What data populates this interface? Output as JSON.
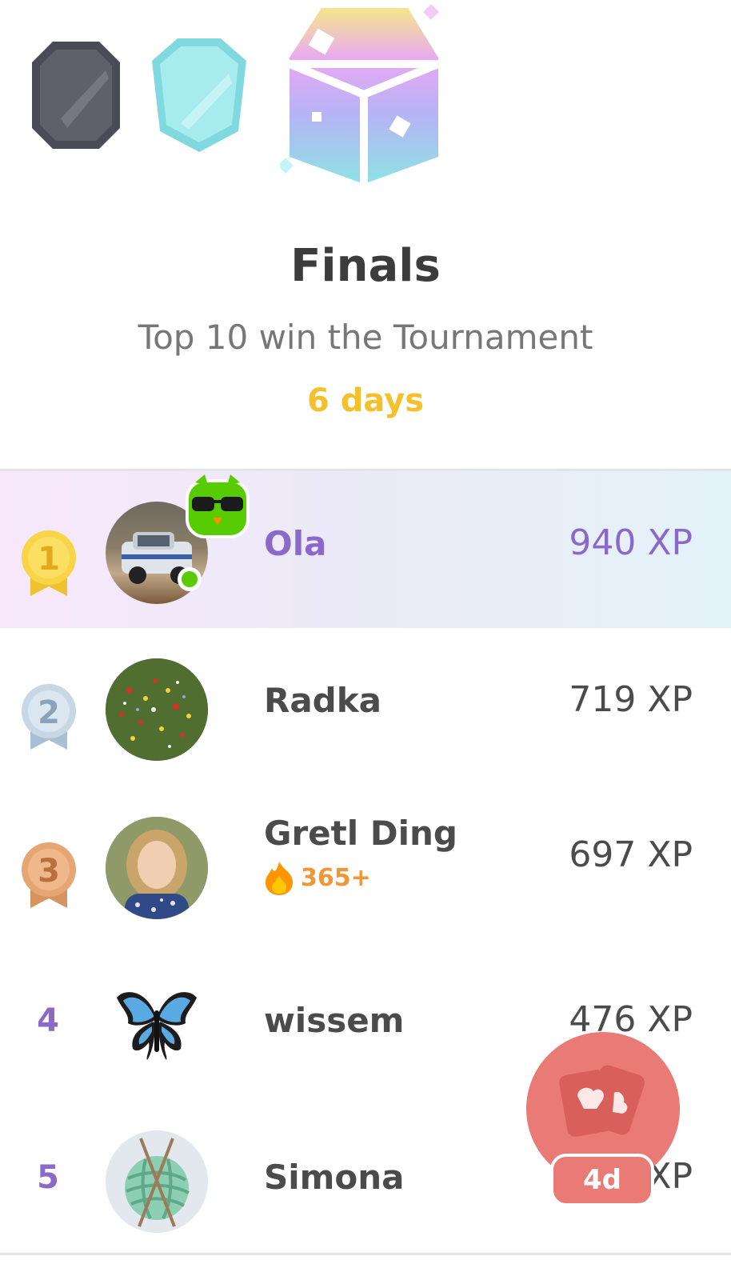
{
  "header": {
    "title": "Finals",
    "subtitle": "Top 10 win the Tournament",
    "time_left": "6 days"
  },
  "colors": {
    "accent_purple": "#8a69c9",
    "timer_yellow": "#f4c02b",
    "streak_orange": "#f19636",
    "fab_red": "#e97a75"
  },
  "leaderboard": [
    {
      "rank": "1",
      "name": "Ola",
      "xp": "940 XP",
      "medal": "gold-medal-icon"
    },
    {
      "rank": "2",
      "name": "Radka",
      "xp": "719 XP",
      "medal": "silver-medal-icon"
    },
    {
      "rank": "3",
      "name": "Gretl Ding",
      "xp": "697 XP",
      "medal": "bronze-medal-icon",
      "streak": "365+"
    },
    {
      "rank": "4",
      "name": "wissem",
      "xp": "476 XP"
    },
    {
      "rank": "5",
      "name": "Simona",
      "xp": "XP"
    }
  ],
  "fab": {
    "badge": "4d"
  }
}
